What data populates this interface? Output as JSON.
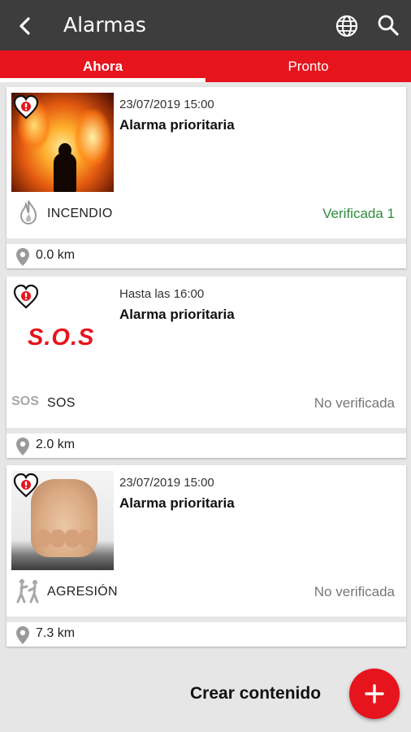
{
  "appbar": {
    "title": "Alarmas",
    "back_icon": "arrow-left-icon",
    "globe_icon": "globe-icon",
    "search_icon": "search-icon"
  },
  "tabs": [
    {
      "label": "Ahora",
      "selected": true
    },
    {
      "label": "Pronto",
      "selected": false
    }
  ],
  "alarms": [
    {
      "date": "23/07/2019 15:00",
      "name": "Alarma prioritaria",
      "category": "INCENDIO",
      "category_icon": "fire-icon",
      "status": "Verificada 1",
      "status_color": "#2e8b3e",
      "distance": "0.0 km",
      "image": "fire-photo"
    },
    {
      "date": "Hasta las 16:00",
      "name": "Alarma prioritaria",
      "category": "SOS",
      "category_icon_text": "SOS",
      "status": "No verificada",
      "distance": "2.0 km",
      "image_text": "S.O.S"
    },
    {
      "date": "23/07/2019 15:00",
      "name": "Alarma prioritaria",
      "category": "AGRESIÓN",
      "category_icon": "aggression-icon",
      "status": "No verificada",
      "distance": "7.3 km",
      "image": "fist-photo"
    }
  ],
  "fab": {
    "label": "Crear contenido",
    "icon": "plus-icon"
  },
  "colors": {
    "accent": "#e6141d",
    "appbar": "#3d3d3d",
    "verified": "#2e8b3e",
    "background": "#e6e6e6"
  }
}
